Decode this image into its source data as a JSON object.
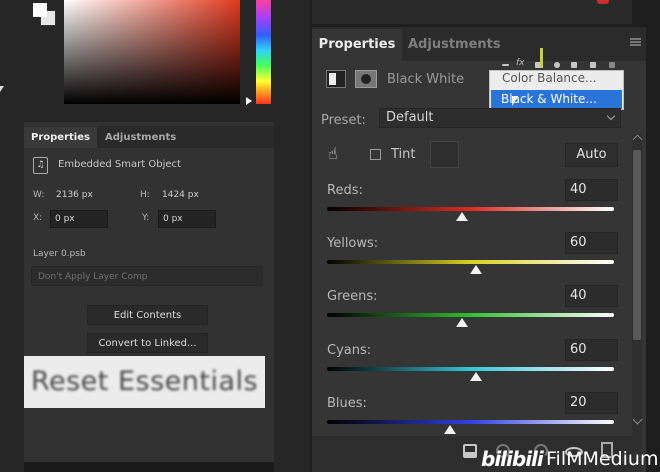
{
  "left_panel": {
    "tabs": [
      "Properties",
      "Adjustments"
    ],
    "smart_object_label": "Embedded Smart Object",
    "width_label": "W:",
    "width_value": "2136 px",
    "height_label": "H:",
    "height_value": "1424 px",
    "x_label": "X:",
    "x_value": "0 px",
    "y_label": "Y:",
    "y_value": "0 px",
    "layer_name": "Layer 0.psb",
    "layer_comp_placeholder": "Don't Apply Layer Comp",
    "edit_contents_button": "Edit Contents",
    "convert_button": "Convert to Linked...",
    "reset_banner": "Reset Essentials"
  },
  "properties_panel": {
    "tabs": [
      "Properties",
      "Adjustments"
    ],
    "adjustment_title": "Black  White",
    "adjustment_dropdown": {
      "items": [
        "Color Balance...",
        "Black & White..."
      ],
      "selected": "Black & White..."
    },
    "preset_label": "Preset:",
    "preset_value": "Default",
    "tint_label": "Tint",
    "tint_checked": false,
    "auto_button": "Auto",
    "sliders": [
      {
        "label": "Reds:",
        "value": "40",
        "fraction": 0.47,
        "gradient": [
          "#000000",
          "#e02a20",
          "#ffffff"
        ]
      },
      {
        "label": "Yellows:",
        "value": "60",
        "fraction": 0.52,
        "gradient": [
          "#000000",
          "#d8d020",
          "#ffffff"
        ]
      },
      {
        "label": "Greens:",
        "value": "40",
        "fraction": 0.47,
        "gradient": [
          "#000000",
          "#30c030",
          "#ffffff"
        ]
      },
      {
        "label": "Cyans:",
        "value": "60",
        "fraction": 0.52,
        "gradient": [
          "#000000",
          "#30c8d8",
          "#ffffff"
        ]
      },
      {
        "label": "Blues:",
        "value": "20",
        "fraction": 0.43,
        "gradient": [
          "#000000",
          "#3040e0",
          "#ffffff"
        ]
      }
    ]
  },
  "watermark": {
    "logo": "bilibili",
    "text": "FilMMedium"
  }
}
